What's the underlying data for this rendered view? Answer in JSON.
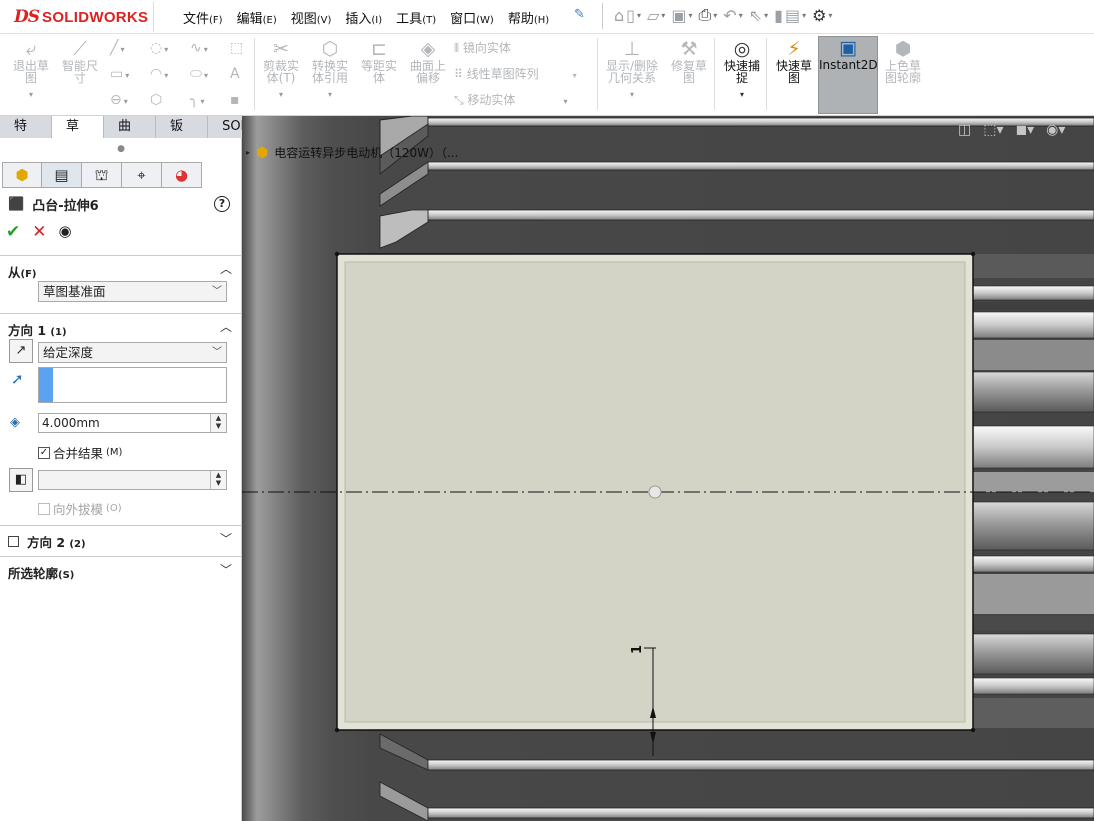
{
  "app": {
    "logo_ds": "DS",
    "logo_name": "SOLIDWORKS"
  },
  "menu": [
    {
      "label": "文件",
      "acc": "(F)"
    },
    {
      "label": "编辑",
      "acc": "(E)"
    },
    {
      "label": "视图",
      "acc": "(V)"
    },
    {
      "label": "插入",
      "acc": "(I)"
    },
    {
      "label": "工具",
      "acc": "(T)"
    },
    {
      "label": "窗口",
      "acc": "(W)"
    },
    {
      "label": "帮助",
      "acc": "(H)"
    }
  ],
  "command_manager": {
    "exit_sketch": "退出草\n图",
    "smart_dim": "智能尺\n寸",
    "trim": "剪裁实\n体(T)",
    "convert": "转换实\n体引用",
    "offset": "等距实\n体",
    "surface_offset": "曲面上\n偏移",
    "mirror": "镜向实体",
    "linear_pattern": "线性草图阵列",
    "move": "移动实体",
    "display_relations": "显示/删除\n几何关系",
    "repair": "修复草\n图",
    "quick_snaps": "快速捕\n捉",
    "rapid_sketch": "快速草\n图",
    "instant2d": "Instant2D",
    "shaded_contours": "上色草\n图轮廓"
  },
  "tabs": [
    {
      "label": "特征",
      "active": false
    },
    {
      "label": "草图",
      "active": true
    },
    {
      "label": "曲面",
      "active": false
    },
    {
      "label": "钣金",
      "active": false
    },
    {
      "label": "SOLIDWORKS 插件",
      "active": false
    }
  ],
  "property_manager": {
    "title": "凸台-拉伸6",
    "from_section": {
      "label": "从",
      "acc": "(F)",
      "value": "草图基准面"
    },
    "dir1_section": {
      "label": "方向 1",
      "acc": "(1)",
      "end_condition": "给定深度",
      "depth": "4.000mm"
    },
    "merge_result": {
      "label": "合并结果",
      "acc": "(M)",
      "checked": true
    },
    "draft_outward": {
      "label": "向外拔模",
      "acc": "(O)",
      "checked": false
    },
    "dir2_section": {
      "label": "方向 2",
      "acc": "(2)"
    },
    "contours_section": {
      "label": "所选轮廓",
      "acc": "(S)"
    }
  },
  "graphics": {
    "feature_tree_label": "电容运转异步电动机（120W）（...",
    "dimension_text": "1"
  },
  "colors": {
    "accent_blue": "#5aa3f0",
    "ok_green": "#2c9c2c",
    "cancel_red": "#d32626",
    "sketch_face": "#d4d4c6",
    "background_dark": "#454545"
  }
}
